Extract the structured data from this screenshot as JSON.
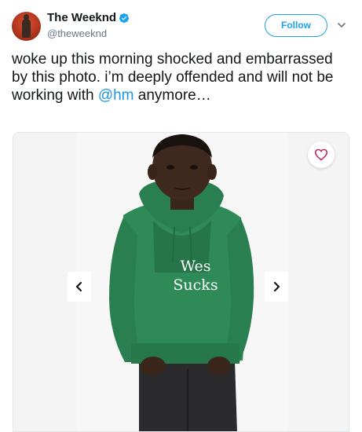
{
  "author": {
    "display_name": "The Weeknd",
    "handle": "@theweeknd",
    "verified": true,
    "avatar_icon": "profile-photo"
  },
  "header": {
    "follow_label": "Follow",
    "menu_icon": "chevron-down-icon"
  },
  "tweet": {
    "text_before_mention": "woke up this morning shocked and embarrassed by this photo. i’m deeply offended and will not be working with ",
    "mention": "@hm",
    "text_after_mention": " anymore…"
  },
  "media": {
    "overlay_text_line1": "Wes",
    "overlay_text_line2": "Sucks",
    "prev_icon": "chevron-left-icon",
    "next_icon": "chevron-right-icon",
    "favorite_icon": "heart-icon"
  },
  "colors": {
    "accent": "#1da1f2",
    "mention": "#1b95e0",
    "heart": "#e0245e",
    "hoodie": "#2e8b57"
  }
}
